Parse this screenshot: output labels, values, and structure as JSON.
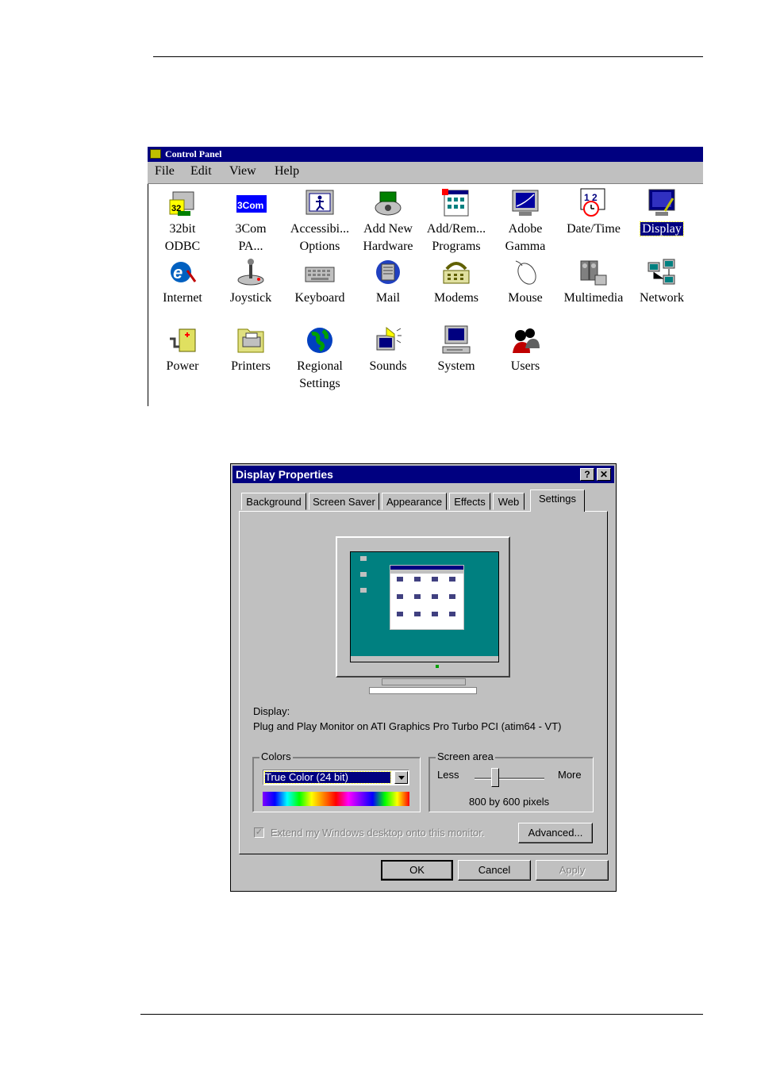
{
  "control_panel": {
    "title": "Control Panel",
    "menu": [
      "File",
      "Edit",
      "View",
      "Help"
    ],
    "items": [
      {
        "label": "32bit\nODBC",
        "icon": "odbc-icon"
      },
      {
        "label": "3Com\nPA...",
        "icon": "3com-icon",
        "icon_text": "3Com"
      },
      {
        "label": "Accessibi...\nOptions",
        "icon": "accessibility-icon"
      },
      {
        "label": "Add New\nHardware",
        "icon": "add-hardware-icon"
      },
      {
        "label": "Add/Rem...\nPrograms",
        "icon": "add-remove-programs-icon"
      },
      {
        "label": "Adobe\nGamma",
        "icon": "adobe-gamma-icon"
      },
      {
        "label": "Date/Time",
        "icon": "date-time-icon",
        "icon_text": "1 2"
      },
      {
        "label": "Display",
        "icon": "display-icon",
        "selected": true
      },
      {
        "label": "Internet",
        "icon": "internet-icon"
      },
      {
        "label": "Joystick",
        "icon": "joystick-icon"
      },
      {
        "label": "Keyboard",
        "icon": "keyboard-icon"
      },
      {
        "label": "Mail",
        "icon": "mail-icon"
      },
      {
        "label": "Modems",
        "icon": "modem-icon"
      },
      {
        "label": "Mouse",
        "icon": "mouse-icon"
      },
      {
        "label": "Multimedia",
        "icon": "multimedia-icon"
      },
      {
        "label": "Network",
        "icon": "network-icon"
      },
      {
        "label": "Power",
        "icon": "power-icon"
      },
      {
        "label": "Printers",
        "icon": "printer-icon"
      },
      {
        "label": "Regional\nSettings",
        "icon": "globe-icon"
      },
      {
        "label": "Sounds",
        "icon": "speaker-icon"
      },
      {
        "label": "System",
        "icon": "computer-icon"
      },
      {
        "label": "Users",
        "icon": "users-icon"
      }
    ]
  },
  "display_properties": {
    "title": "Display Properties",
    "help_button": "?",
    "close_button": "✕",
    "tabs": [
      "Background",
      "Screen Saver",
      "Appearance",
      "Effects",
      "Web",
      "Settings"
    ],
    "active_tab": "Settings",
    "display_label": "Display:",
    "display_value": "Plug and Play Monitor on ATI Graphics Pro Turbo PCI (atim64 - VT)",
    "colors": {
      "legend": "Colors",
      "selected": "True Color (24 bit)"
    },
    "screen_area": {
      "legend": "Screen area",
      "less": "Less",
      "more": "More",
      "value": "800 by 600 pixels",
      "slider_fraction": 0.3
    },
    "extend_checkbox": {
      "label": "Extend my Windows desktop onto this monitor.",
      "checked": true
    },
    "advanced_button": "Advanced...",
    "ok_button": "OK",
    "cancel_button": "Cancel",
    "apply_button": "Apply"
  },
  "colors": {
    "titlebar": "#000080",
    "dialog_face": "#c0c0c0",
    "desktop": "#008080"
  }
}
